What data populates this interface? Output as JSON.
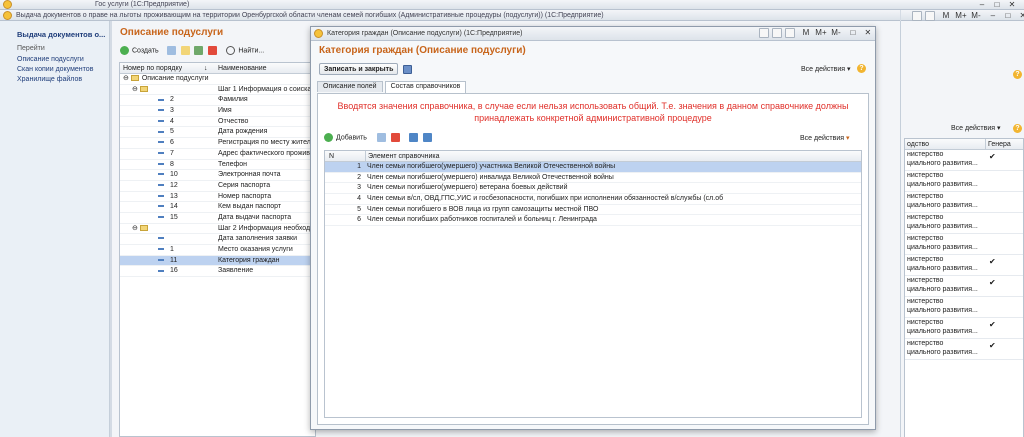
{
  "app_window": {
    "title": "Гос услуги  (1С:Предприятие)",
    "subtitle": "Выдача документов о праве на льготы проживающим на территории Оренбургской области членам семей погибших (Административные процедуры (подуслуги))  (1С:Предприятие)"
  },
  "sidebar": {
    "title": "Выдача документов о...",
    "goto_label": "Перейти",
    "items": [
      {
        "label": "Описание подуслуги"
      },
      {
        "label": "Скан копии документов"
      },
      {
        "label": "Хранилище файлов"
      }
    ]
  },
  "subservice": {
    "title": "Описание подуслуги",
    "create_label": "Создать",
    "find_label": "Найти...",
    "columns": [
      "Номер по порядку",
      "Наименование"
    ],
    "rows": [
      {
        "num": "Описание подуслуги",
        "name": "",
        "type": "root"
      },
      {
        "num": "",
        "name": "Шаг 1 Информация о соискате...",
        "type": "folder"
      },
      {
        "num": "2",
        "name": "Фамилия",
        "type": "item"
      },
      {
        "num": "3",
        "name": "Имя",
        "type": "item"
      },
      {
        "num": "4",
        "name": "Отчество",
        "type": "item"
      },
      {
        "num": "5",
        "name": "Дата рождения",
        "type": "item"
      },
      {
        "num": "6",
        "name": "Регистрация по месту житель...",
        "type": "item"
      },
      {
        "num": "7",
        "name": "Адрес фактического прожива...",
        "type": "item"
      },
      {
        "num": "8",
        "name": "Телефон",
        "type": "item"
      },
      {
        "num": "10",
        "name": "Электронная почта",
        "type": "item"
      },
      {
        "num": "12",
        "name": "Серия паспорта",
        "type": "item"
      },
      {
        "num": "13",
        "name": "Номер паспорта",
        "type": "item"
      },
      {
        "num": "14",
        "name": "Кем выдан паспорт",
        "type": "item"
      },
      {
        "num": "15",
        "name": "Дата выдачи паспорта",
        "type": "item"
      },
      {
        "num": "",
        "name": "Шаг 2 Информация необходим...",
        "type": "folder"
      },
      {
        "num": "",
        "name": "Дата заполнения заявки",
        "type": "item"
      },
      {
        "num": "1",
        "name": "Место оказания услуги",
        "type": "item"
      },
      {
        "num": "11",
        "name": "Категория граждан",
        "type": "item",
        "selected": true
      },
      {
        "num": "16",
        "name": "Заявление",
        "type": "item"
      }
    ]
  },
  "right_panel": {
    "all_actions": "Все действия",
    "columns": [
      "одство",
      "Генера"
    ],
    "rows": [
      {
        "text": "нистерство",
        "text2": "циального развития...",
        "check": true
      },
      {
        "text": "нистерство",
        "text2": "циального развития...",
        "check": false
      },
      {
        "text": "нистерство",
        "text2": "циального развития...",
        "check": false
      },
      {
        "text": "нистерство",
        "text2": "циального развития...",
        "check": false
      },
      {
        "text": "нистерство",
        "text2": "циального развития...",
        "check": false
      },
      {
        "text": "нистерство",
        "text2": "циального развития...",
        "check": true
      },
      {
        "text": "нистерство",
        "text2": "циального развития...",
        "check": true
      },
      {
        "text": "нистерство",
        "text2": "циального развития...",
        "check": false
      },
      {
        "text": "нистерство",
        "text2": "циального развития...",
        "check": true
      },
      {
        "text": "нистерство",
        "text2": "циального развития...",
        "check": true
      }
    ]
  },
  "dialog": {
    "window_title": "Категория граждан (Описание подуслуги)  (1С:Предприятие)",
    "title": "Категория граждан (Описание подуслуги)",
    "save_close": "Записать и закрыть",
    "all_actions": "Все действия",
    "tabs": [
      {
        "label": "Описание полей",
        "active": false
      },
      {
        "label": "Состав справочников",
        "active": true
      }
    ],
    "notice": "Вводятся значения справочника, в случае если нельзя использовать общий. Т.е. значения в данном справочнике должны принадлежать конкретной административной процедуре",
    "add_label": "Добавить",
    "inner_all_actions": "Все действия",
    "columns": [
      "N",
      "Элемент справочника"
    ],
    "rows": [
      {
        "n": "1",
        "text": "Член семьи погибшего(умершего) участника Великой Отечественной войны",
        "selected": true
      },
      {
        "n": "2",
        "text": "Член семьи погибшего(умершего) инвалида Великой Отечественной войны",
        "selected": false
      },
      {
        "n": "3",
        "text": "Член семьи погибшего(умершего) ветерана боевых действий",
        "selected": false
      },
      {
        "n": "4",
        "text": "Член семьи в/сл, ОВД,ГПС,УИС и госбезопасности, погибших при исполнении обязанностей в/службы (сл.об",
        "selected": false
      },
      {
        "n": "5",
        "text": "Член семьи погибшего в ВОВ лица из групп самозащиты местной ПВО",
        "selected": false
      },
      {
        "n": "6",
        "text": "Член семьи погибших работников госпиталей и больниц г. Ленинграда",
        "selected": false
      }
    ]
  },
  "colors": {
    "accent_orange": "#c8651b",
    "notice_red": "#e0302a",
    "selection": "#bdd2f0"
  }
}
